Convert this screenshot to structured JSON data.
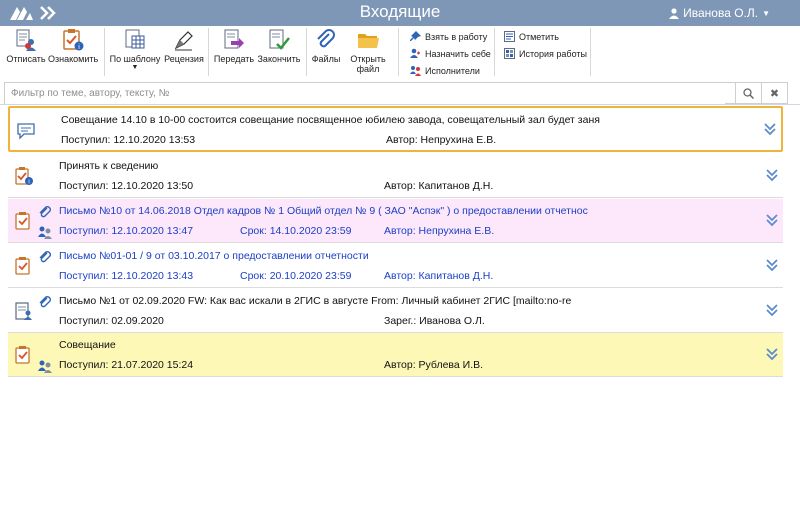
{
  "app": {
    "title": "Входящие",
    "user": "Иванова О.Л."
  },
  "toolbar": {
    "reply": "Отписать",
    "acknowledge": "Ознакомить",
    "by_template": "По шаблону",
    "review": "Рецензия",
    "forward": "Передать",
    "finish": "Закончить",
    "files": "Файлы",
    "open_file_line1": "Открыть",
    "open_file_line2": "файл",
    "take_to_work": "Взять в работу",
    "assign_self": "Назначить себе",
    "executors": "Исполнители",
    "mark": "Отметить",
    "history": "История работы"
  },
  "filter": {
    "placeholder": "Фильтр по теме, автору, тексту, №"
  },
  "items": [
    {
      "subject": "Совещание 14.10 в 10-00 состоится совещание посвященное юбилею завода, совещательный зал будет заня",
      "received": "Поступил: 12.10.2020 13:53",
      "due": "",
      "author": "Автор: Непрухина Е.В."
    },
    {
      "subject": "Принять к сведению",
      "received": "Поступил: 12.10.2020 13:50",
      "due": "",
      "author": "Автор: Капитанов Д.Н."
    },
    {
      "subject": "Письмо №10 от 14.06.2018 Отдел кадров № 1 Общий отдел № 9 ( ЗАО \"Аспэк\" ) о предоставлении отчетнос",
      "received": "Поступил: 12.10.2020 13:47",
      "due": "Срок: 14.10.2020 23:59",
      "author": "Автор: Непрухина Е.В."
    },
    {
      "subject": "Письмо №01-01 / 9 от 03.10.2017 о предоставлении отчетности",
      "received": "Поступил: 12.10.2020 13:43",
      "due": "Срок: 20.10.2020 23:59",
      "author": "Автор: Капитанов Д.Н."
    },
    {
      "subject": "Письмо №1 от 02.09.2020 FW: Как вас искали в 2ГИС в августе From: Личный кабинет 2ГИС [mailto:no-re",
      "received": "Поступил: 02.09.2020",
      "due": "",
      "author": "Зарег.: Иванова О.Л."
    },
    {
      "subject": "Совещание",
      "received": "Поступил: 21.07.2020 15:24",
      "due": "",
      "author": "Автор: Рублева И.В."
    }
  ],
  "colors": {
    "titlebar": "#7f97b7",
    "selected_border": "#f0b43c",
    "pink_row": "#fde8fb",
    "yellow_row": "#fdf8b6",
    "link_blue": "#1a3fc6"
  }
}
